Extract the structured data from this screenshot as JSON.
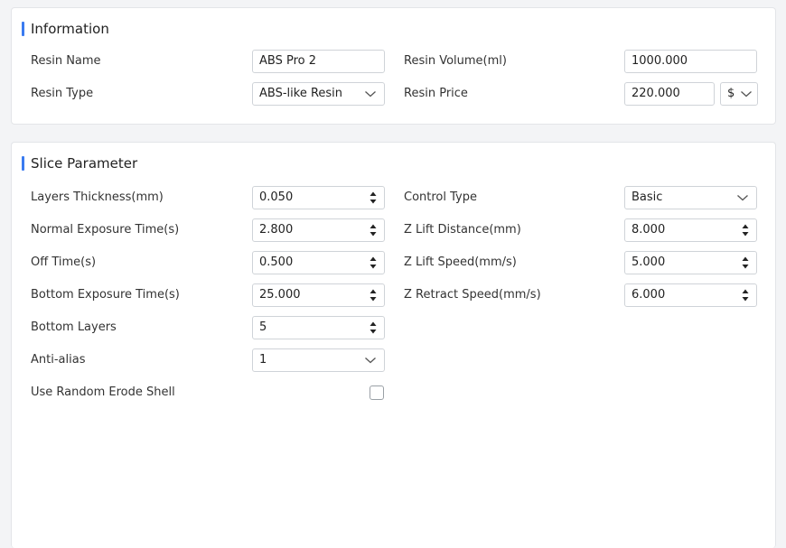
{
  "information": {
    "title": "Information",
    "resin_name_label": "Resin Name",
    "resin_name_value": "ABS Pro 2",
    "resin_volume_label": "Resin Volume(ml)",
    "resin_volume_value": "1000.000",
    "resin_type_label": "Resin Type",
    "resin_type_value": "ABS-like Resin",
    "resin_price_label": "Resin Price",
    "resin_price_value": "220.000",
    "currency_value": "$"
  },
  "slice": {
    "title": "Slice Parameter",
    "layers_thickness_label": "Layers Thickness(mm)",
    "layers_thickness_value": "0.050",
    "normal_exposure_label": "Normal Exposure Time(s)",
    "normal_exposure_value": "2.800",
    "off_time_label": "Off Time(s)",
    "off_time_value": "0.500",
    "bottom_exposure_label": "Bottom Exposure Time(s)",
    "bottom_exposure_value": "25.000",
    "bottom_layers_label": "Bottom Layers",
    "bottom_layers_value": "5",
    "anti_alias_label": "Anti-alias",
    "anti_alias_value": "1",
    "random_erode_label": "Use Random Erode Shell",
    "control_type_label": "Control Type",
    "control_type_value": "Basic",
    "z_lift_distance_label": "Z Lift Distance(mm)",
    "z_lift_distance_value": "8.000",
    "z_lift_speed_label": "Z Lift Speed(mm/s)",
    "z_lift_speed_value": "5.000",
    "z_retract_speed_label": "Z Retract Speed(mm/s)",
    "z_retract_speed_value": "6.000"
  },
  "colors": {
    "accent": "#3a7bf0",
    "border": "#cfd3d8"
  },
  "icons": {
    "dropdown": "chevron-down-icon",
    "stepper": "spinner-arrows-icon",
    "checkbox": "checkbox-unchecked"
  }
}
